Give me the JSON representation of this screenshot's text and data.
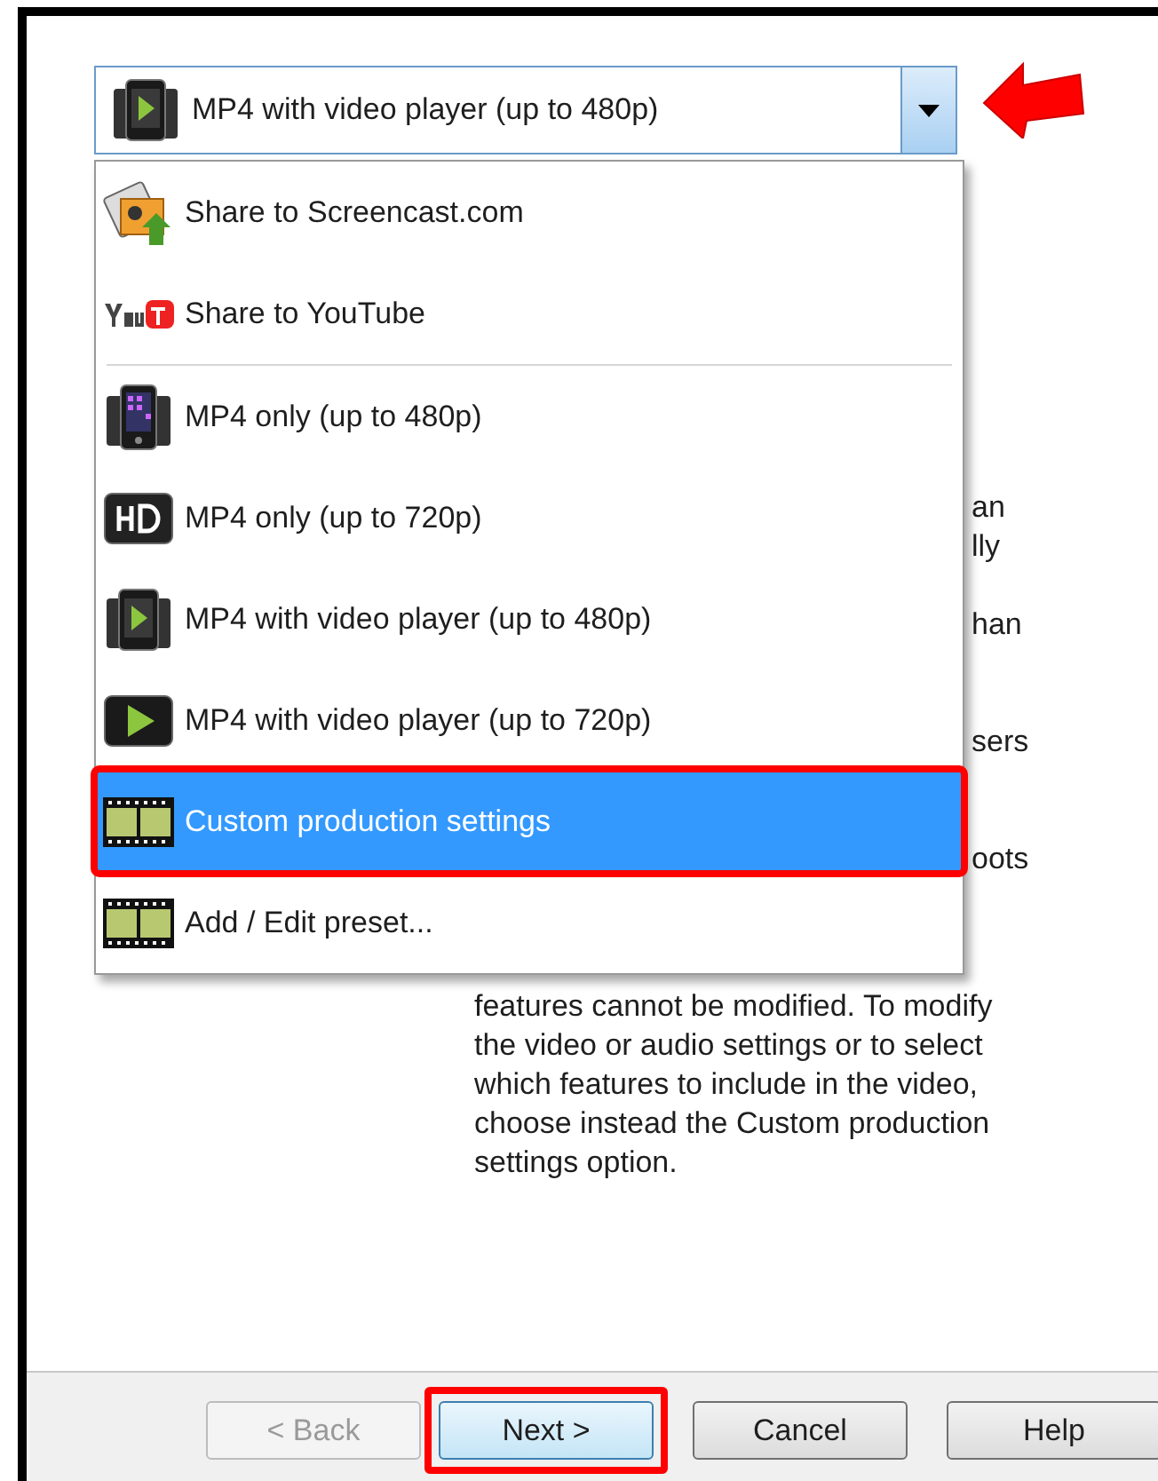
{
  "combo": {
    "value": "MP4 with video player (up to 480p)",
    "expanded": true,
    "highlighted": true
  },
  "menu": {
    "items": [
      {
        "label": "Share to Screencast.com",
        "selected": false,
        "highlighted": false,
        "divider_after": false
      },
      {
        "label": "Share to YouTube",
        "selected": false,
        "highlighted": false,
        "divider_after": true
      },
      {
        "label": "MP4 only (up to 480p)",
        "selected": false,
        "highlighted": false,
        "divider_after": false
      },
      {
        "label": "MP4 only (up to 720p)",
        "selected": false,
        "highlighted": false,
        "divider_after": false
      },
      {
        "label": "MP4 with video player (up to 480p)",
        "selected": false,
        "highlighted": false,
        "divider_after": false
      },
      {
        "label": "MP4 with video player (up to 720p)",
        "selected": false,
        "highlighted": false,
        "divider_after": false
      },
      {
        "label": "Custom production settings",
        "selected": true,
        "highlighted": true,
        "divider_after": false
      },
      {
        "label": "Add / Edit preset...",
        "selected": false,
        "highlighted": false,
        "divider_after": false
      }
    ]
  },
  "description": {
    "fragments": [
      "an",
      "lly",
      "han",
      "sers",
      "oots"
    ],
    "paragraph": "features cannot be modified.  To modify the video or audio settings or to select which features to include in the video, choose instead the Custom production settings option."
  },
  "buttons": [
    {
      "label": "< Back",
      "disabled": true,
      "focused": false,
      "highlighted": false
    },
    {
      "label": "Next >",
      "disabled": false,
      "focused": true,
      "highlighted": true
    },
    {
      "label": "Cancel",
      "disabled": false,
      "focused": false,
      "highlighted": false
    },
    {
      "label": "Help",
      "disabled": false,
      "focused": false,
      "highlighted": false
    }
  ]
}
